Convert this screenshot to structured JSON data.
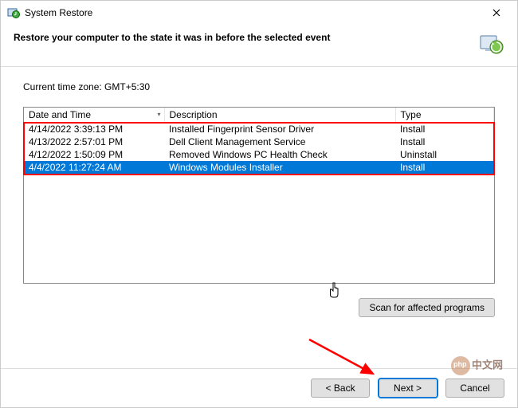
{
  "window": {
    "title": "System Restore",
    "heading": "Restore your computer to the state it was in before the selected event",
    "timezone_label": "Current time zone: GMT+5:30"
  },
  "table": {
    "columns": {
      "date": "Date and Time",
      "desc": "Description",
      "type": "Type"
    },
    "rows": [
      {
        "date": "4/14/2022 3:39:13 PM",
        "desc": "Installed Fingerprint Sensor Driver",
        "type": "Install",
        "selected": false
      },
      {
        "date": "4/13/2022 2:57:01 PM",
        "desc": "Dell Client Management Service",
        "type": "Install",
        "selected": false
      },
      {
        "date": "4/12/2022 1:50:09 PM",
        "desc": "Removed Windows PC Health Check",
        "type": "Uninstall",
        "selected": false
      },
      {
        "date": "4/4/2022 11:27:24 AM",
        "desc": "Windows Modules Installer",
        "type": "Install",
        "selected": true
      }
    ]
  },
  "buttons": {
    "scan": "Scan for affected programs",
    "back": "< Back",
    "next": "Next >",
    "cancel": "Cancel"
  },
  "watermark": "中文网"
}
